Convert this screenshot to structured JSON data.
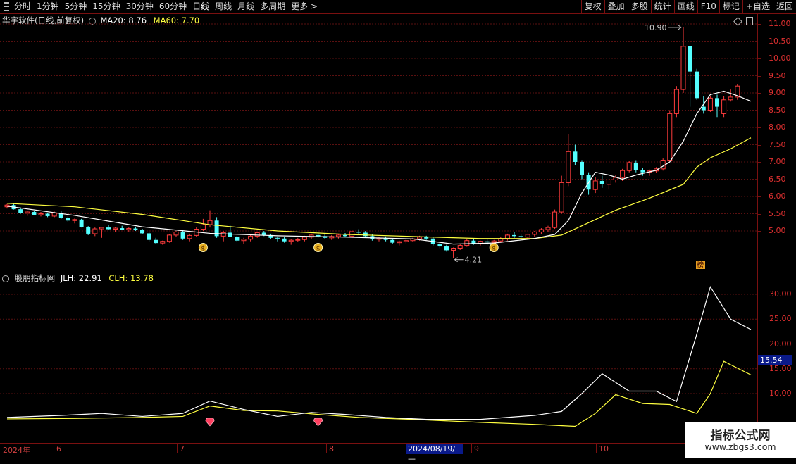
{
  "toolbar": {
    "periods": [
      "分时",
      "1分钟",
      "5分钟",
      "15分钟",
      "30分钟",
      "60分钟",
      "日线",
      "周线",
      "月线",
      "多周期",
      "更多 >"
    ],
    "active_period": "日线",
    "right_buttons": [
      "复权",
      "叠加",
      "多股",
      "统计",
      "画线",
      "F10",
      "标记",
      "+自选",
      "返回"
    ]
  },
  "main_panel": {
    "stock_title": "华宇软件(日线,前复权)",
    "ma20_label": "MA20: 8.76",
    "ma60_label": "MA60: 7.70",
    "high_annotation": "10.90",
    "low_annotation": "4.21",
    "badge_text": "榜",
    "price_ticks": [
      "11.00",
      "10.50",
      "10.00",
      "9.50",
      "9.00",
      "8.50",
      "8.00",
      "7.50",
      "7.00",
      "6.50",
      "6.00",
      "5.50",
      "5.00"
    ],
    "colors": {
      "up": "#ff3c3c",
      "down": "#54ffff",
      "ma20": "#ffffff",
      "ma60": "#ffff40",
      "grid": "#5a1010"
    }
  },
  "sub_panel": {
    "indicator_title": "股朋指标网",
    "jlh_label": "JLH: 22.91",
    "clh_label": "CLH: 13.78",
    "axis_ticks": [
      "30.00",
      "25.00",
      "20.00",
      "15.00",
      "10.00"
    ],
    "current_value": "15.54",
    "colors": {
      "jlh": "#ffffff",
      "clh": "#ffff40"
    }
  },
  "date_axis": {
    "year_label": "2024年",
    "months": [
      "6",
      "7",
      "8",
      "9",
      "10"
    ],
    "cursor_date": "2024/08/19/—"
  },
  "watermark": {
    "title": "指标公式网",
    "url": "www.zbgs3.com"
  },
  "chart_data": {
    "type": "candlestick",
    "title": "华宇软件(日线,前复权)",
    "ylim": [
      4.0,
      11.4
    ],
    "ohlc": [
      [
        5.7,
        5.78,
        5.65,
        5.75
      ],
      [
        5.75,
        5.8,
        5.62,
        5.63
      ],
      [
        5.63,
        5.68,
        5.5,
        5.52
      ],
      [
        5.52,
        5.58,
        5.44,
        5.55
      ],
      [
        5.55,
        5.57,
        5.45,
        5.47
      ],
      [
        5.47,
        5.55,
        5.42,
        5.5
      ],
      [
        5.5,
        5.52,
        5.4,
        5.43
      ],
      [
        5.43,
        5.56,
        5.4,
        5.52
      ],
      [
        5.52,
        5.58,
        5.35,
        5.38
      ],
      [
        5.38,
        5.42,
        5.26,
        5.3
      ],
      [
        5.3,
        5.36,
        5.22,
        5.33
      ],
      [
        5.33,
        5.35,
        5.1,
        5.12
      ],
      [
        5.12,
        5.14,
        4.88,
        4.92
      ],
      [
        4.92,
        5.1,
        4.85,
        5.06
      ],
      [
        5.06,
        5.12,
        4.8,
        5.1
      ],
      [
        5.1,
        5.18,
        5.02,
        5.05
      ],
      [
        5.05,
        5.12,
        4.98,
        5.08
      ],
      [
        5.08,
        5.15,
        5.02,
        5.04
      ],
      [
        5.04,
        5.1,
        4.98,
        5.07
      ],
      [
        5.07,
        5.12,
        5.0,
        5.03
      ],
      [
        5.03,
        5.06,
        4.9,
        4.93
      ],
      [
        4.93,
        4.98,
        4.7,
        4.74
      ],
      [
        4.74,
        4.8,
        4.62,
        4.65
      ],
      [
        4.65,
        4.72,
        4.6,
        4.7
      ],
      [
        4.7,
        4.9,
        4.66,
        4.88
      ],
      [
        4.88,
        5.0,
        4.82,
        4.97
      ],
      [
        4.97,
        5.02,
        4.74,
        4.78
      ],
      [
        4.78,
        4.92,
        4.7,
        4.87
      ],
      [
        4.87,
        5.1,
        4.82,
        5.05
      ],
      [
        5.05,
        5.35,
        5.0,
        5.18
      ],
      [
        5.18,
        5.6,
        5.1,
        5.3
      ],
      [
        5.3,
        5.4,
        4.8,
        4.85
      ],
      [
        4.85,
        5.0,
        4.7,
        4.95
      ],
      [
        4.95,
        5.15,
        4.82,
        4.82
      ],
      [
        4.82,
        4.86,
        4.68,
        4.72
      ],
      [
        4.72,
        4.8,
        4.62,
        4.76
      ],
      [
        4.76,
        4.88,
        4.7,
        4.85
      ],
      [
        4.85,
        4.98,
        4.8,
        4.95
      ],
      [
        4.95,
        5.0,
        4.85,
        4.88
      ],
      [
        4.88,
        4.92,
        4.76,
        4.8
      ],
      [
        4.8,
        4.84,
        4.7,
        4.78
      ],
      [
        4.78,
        4.82,
        4.66,
        4.7
      ],
      [
        4.7,
        4.76,
        4.6,
        4.73
      ],
      [
        4.73,
        4.8,
        4.68,
        4.75
      ],
      [
        4.75,
        4.86,
        4.7,
        4.82
      ],
      [
        4.82,
        4.92,
        4.76,
        4.88
      ],
      [
        4.88,
        4.96,
        4.8,
        4.85
      ],
      [
        4.85,
        4.9,
        4.76,
        4.8
      ],
      [
        4.8,
        4.88,
        4.74,
        4.84
      ],
      [
        4.84,
        4.92,
        4.78,
        4.88
      ],
      [
        4.88,
        4.94,
        4.82,
        4.85
      ],
      [
        4.85,
        5.02,
        4.8,
        4.98
      ],
      [
        4.98,
        5.05,
        4.9,
        4.95
      ],
      [
        4.95,
        5.0,
        4.82,
        4.85
      ],
      [
        4.85,
        4.9,
        4.72,
        4.76
      ],
      [
        4.76,
        4.82,
        4.7,
        4.79
      ],
      [
        4.79,
        4.84,
        4.7,
        4.74
      ],
      [
        4.74,
        4.78,
        4.62,
        4.66
      ],
      [
        4.66,
        4.72,
        4.58,
        4.69
      ],
      [
        4.69,
        4.76,
        4.64,
        4.72
      ],
      [
        4.72,
        4.8,
        4.68,
        4.77
      ],
      [
        4.77,
        4.86,
        4.72,
        4.82
      ],
      [
        4.82,
        4.86,
        4.74,
        4.78
      ],
      [
        4.78,
        4.82,
        4.58,
        4.62
      ],
      [
        4.62,
        4.68,
        4.5,
        4.55
      ],
      [
        4.55,
        4.6,
        4.4,
        4.44
      ],
      [
        4.44,
        4.52,
        4.21,
        4.5
      ],
      [
        4.5,
        4.62,
        4.45,
        4.58
      ],
      [
        4.58,
        4.76,
        4.54,
        4.72
      ],
      [
        4.72,
        4.78,
        4.6,
        4.64
      ],
      [
        4.64,
        4.72,
        4.58,
        4.7
      ],
      [
        4.7,
        4.78,
        4.6,
        4.67
      ],
      [
        4.67,
        4.74,
        4.62,
        4.71
      ],
      [
        4.71,
        4.82,
        4.66,
        4.78
      ],
      [
        4.78,
        4.92,
        4.72,
        4.88
      ],
      [
        4.88,
        4.96,
        4.8,
        4.85
      ],
      [
        4.85,
        4.92,
        4.76,
        4.82
      ],
      [
        4.82,
        4.92,
        4.78,
        4.9
      ],
      [
        4.9,
        5.0,
        4.84,
        4.97
      ],
      [
        4.97,
        5.08,
        4.9,
        5.04
      ],
      [
        5.04,
        5.15,
        4.98,
        5.1
      ],
      [
        5.1,
        5.62,
        5.06,
        5.55
      ],
      [
        5.55,
        6.6,
        5.5,
        6.4
      ],
      [
        6.4,
        7.8,
        6.3,
        7.3
      ],
      [
        7.3,
        7.5,
        6.9,
        7.0
      ],
      [
        7.0,
        7.05,
        6.5,
        6.62
      ],
      [
        6.62,
        6.7,
        6.05,
        6.2
      ],
      [
        6.2,
        6.55,
        6.1,
        6.45
      ],
      [
        6.45,
        6.6,
        6.25,
        6.35
      ],
      [
        6.35,
        6.5,
        6.2,
        6.48
      ],
      [
        6.48,
        6.62,
        6.4,
        6.55
      ],
      [
        6.55,
        6.8,
        6.45,
        6.75
      ],
      [
        6.75,
        7.02,
        6.7,
        6.98
      ],
      [
        6.98,
        7.05,
        6.7,
        6.76
      ],
      [
        6.76,
        6.82,
        6.6,
        6.7
      ],
      [
        6.7,
        6.78,
        6.6,
        6.74
      ],
      [
        6.74,
        6.85,
        6.68,
        6.8
      ],
      [
        6.8,
        7.1,
        6.75,
        7.05
      ],
      [
        7.05,
        8.5,
        7.0,
        8.4
      ],
      [
        8.4,
        9.2,
        8.3,
        9.1
      ],
      [
        9.1,
        10.9,
        9.0,
        10.35
      ],
      [
        10.35,
        10.25,
        8.6,
        9.62
      ],
      [
        9.62,
        9.7,
        8.8,
        8.85
      ],
      [
        8.6,
        8.9,
        8.4,
        8.5
      ],
      [
        8.5,
        8.9,
        8.45,
        8.85
      ],
      [
        8.85,
        8.95,
        8.3,
        8.6
      ],
      [
        8.4,
        8.9,
        8.3,
        8.8
      ],
      [
        8.8,
        9.1,
        8.75,
        8.88
      ],
      [
        8.88,
        9.25,
        8.8,
        9.2
      ]
    ],
    "ma20_points": [
      [
        0,
        5.72
      ],
      [
        10,
        5.45
      ],
      [
        20,
        5.12
      ],
      [
        30,
        4.93
      ],
      [
        40,
        4.86
      ],
      [
        50,
        4.82
      ],
      [
        60,
        4.77
      ],
      [
        66,
        4.62
      ],
      [
        72,
        4.65
      ],
      [
        78,
        4.78
      ],
      [
        81,
        4.9
      ],
      [
        83,
        5.3
      ],
      [
        85,
        6.1
      ],
      [
        87,
        6.7
      ],
      [
        89,
        6.62
      ],
      [
        91,
        6.5
      ],
      [
        93,
        6.62
      ],
      [
        96,
        6.76
      ],
      [
        98,
        7.0
      ],
      [
        100,
        7.6
      ],
      [
        102,
        8.4
      ],
      [
        104,
        8.95
      ],
      [
        106,
        9.05
      ],
      [
        108,
        8.92
      ],
      [
        110,
        8.76
      ]
    ],
    "ma60_points": [
      [
        0,
        5.8
      ],
      [
        10,
        5.7
      ],
      [
        20,
        5.48
      ],
      [
        30,
        5.18
      ],
      [
        40,
        5.0
      ],
      [
        50,
        4.9
      ],
      [
        60,
        4.84
      ],
      [
        70,
        4.78
      ],
      [
        78,
        4.78
      ],
      [
        82,
        4.88
      ],
      [
        85,
        5.15
      ],
      [
        90,
        5.6
      ],
      [
        95,
        5.95
      ],
      [
        100,
        6.35
      ],
      [
        102,
        6.85
      ],
      [
        104,
        7.12
      ],
      [
        107,
        7.38
      ],
      [
        110,
        7.7
      ]
    ],
    "markers": [
      {
        "index": 29,
        "type": "money"
      },
      {
        "index": 46,
        "type": "money"
      },
      {
        "index": 72,
        "type": "money"
      }
    ],
    "sub_series": {
      "JLH": [
        [
          0,
          5.2
        ],
        [
          8,
          5.6
        ],
        [
          14,
          6.0
        ],
        [
          20,
          5.4
        ],
        [
          26,
          6.0
        ],
        [
          30,
          8.5
        ],
        [
          35,
          6.8
        ],
        [
          40,
          5.4
        ],
        [
          45,
          6.2
        ],
        [
          50,
          5.8
        ],
        [
          56,
          5.2
        ],
        [
          62,
          4.8
        ],
        [
          70,
          4.8
        ],
        [
          78,
          5.6
        ],
        [
          82,
          6.4
        ],
        [
          85,
          10.0
        ],
        [
          88,
          14.0
        ],
        [
          92,
          10.5
        ],
        [
          96,
          10.5
        ],
        [
          99,
          8.4
        ],
        [
          102,
          22.0
        ],
        [
          104,
          31.5
        ],
        [
          107,
          25.0
        ],
        [
          110,
          22.91
        ]
      ],
      "CLH": [
        [
          0,
          4.9
        ],
        [
          10,
          5.0
        ],
        [
          20,
          5.2
        ],
        [
          26,
          5.4
        ],
        [
          30,
          7.5
        ],
        [
          35,
          6.6
        ],
        [
          40,
          6.5
        ],
        [
          46,
          5.8
        ],
        [
          52,
          5.2
        ],
        [
          60,
          4.8
        ],
        [
          70,
          4.2
        ],
        [
          78,
          3.8
        ],
        [
          84,
          3.4
        ],
        [
          87,
          6.0
        ],
        [
          90,
          9.8
        ],
        [
          94,
          8.0
        ],
        [
          98,
          7.8
        ],
        [
          102,
          6.0
        ],
        [
          104,
          10.0
        ],
        [
          106,
          16.5
        ],
        [
          110,
          13.78
        ]
      ],
      "ylim": [
        0,
        35
      ],
      "markers": [
        {
          "index": 30,
          "type": "heart"
        },
        {
          "index": 46,
          "type": "heart"
        }
      ]
    }
  }
}
